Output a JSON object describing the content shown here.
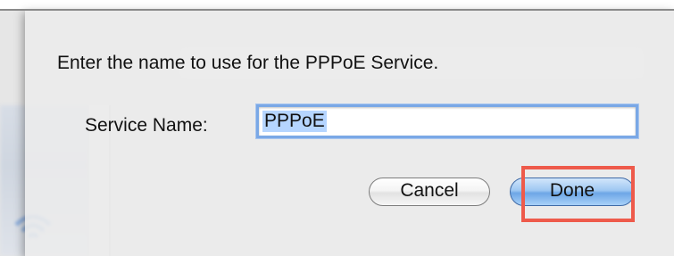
{
  "dialog": {
    "prompt": "Enter the name to use for the PPPoE Service.",
    "field_label": "Service Name:",
    "field_value": "PPPoE",
    "cancel_label": "Cancel",
    "done_label": "Done"
  },
  "annotation": {
    "highlight_color": "#ee5a4b",
    "target": "done-button"
  }
}
